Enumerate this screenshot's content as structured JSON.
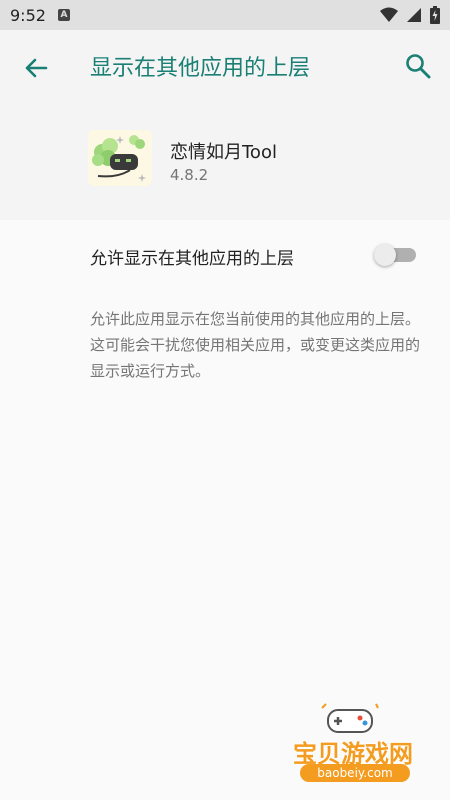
{
  "status_bar": {
    "time": "9:52",
    "notification_icon": "a-icon",
    "icons": [
      "wifi-icon",
      "signal-icon",
      "battery-icon"
    ]
  },
  "app_bar": {
    "title": "显示在其他应用的上层",
    "back_icon": "arrow-left-icon",
    "search_icon": "search-icon"
  },
  "app_info": {
    "name": "恋情如月Tool",
    "version": "4.8.2",
    "icon": "clover-app-icon"
  },
  "setting": {
    "label": "允许显示在其他应用的上层",
    "enabled": false,
    "description": "允许此应用显示在您当前使用的其他应用的上层。这可能会干扰您使用相关应用，或变更这类应用的显示或运行方式。"
  },
  "watermark": {
    "text": "宝贝游戏网",
    "url": "baobeiy.com"
  },
  "colors": {
    "accent": "#1a7f74",
    "background": "#fafafa",
    "header_background": "#f4f4f4",
    "status_bar": "#e0e0e0",
    "secondary_text": "#757575",
    "watermark": "#f39c1f"
  }
}
